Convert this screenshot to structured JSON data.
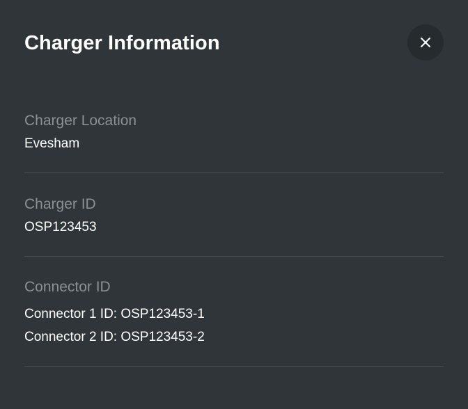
{
  "dialog": {
    "title": "Charger Information",
    "close_icon": "close-icon"
  },
  "sections": [
    {
      "label": "Charger Location",
      "values": [
        "Evesham"
      ]
    },
    {
      "label": "Charger ID",
      "values": [
        "OSP123453"
      ]
    },
    {
      "label": "Connector ID",
      "values": [
        "Connector 1 ID: OSP123453-1",
        "Connector 2 ID: OSP123453-2"
      ]
    }
  ],
  "colors": {
    "background": "#2f3538",
    "close_button_bg": "#262b2e",
    "label_text": "#8a9093",
    "value_text": "#ffffff",
    "divider": "#4a5053"
  }
}
